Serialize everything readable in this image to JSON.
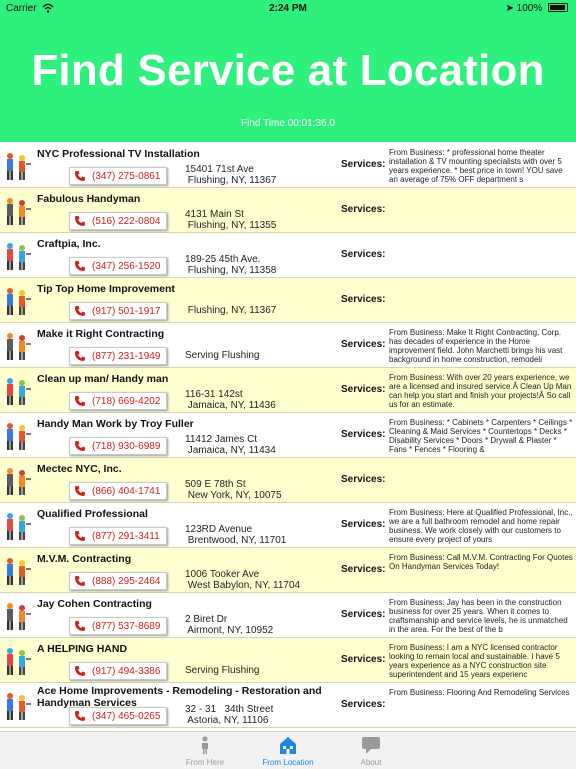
{
  "status": {
    "carrier": "Carrier",
    "time": "2:24 PM",
    "battery": "100%"
  },
  "header": {
    "title": "Find Service at Location",
    "find_time": "Find Time 00:01:36.0"
  },
  "services_label": "Services:",
  "listings": [
    {
      "name": "NYC Professional TV Installation",
      "phone": "(347) 275-0861",
      "address": "15401 71st Ave\n Flushing, NY, 11367",
      "description": "From Business: * professional home theater installation & TV mounting specialists with over 5 years experience. * best price in town! YOU save an average of 75% OFF department s"
    },
    {
      "name": "Fabulous Handyman",
      "phone": "(516) 222-0804",
      "address": "4131 Main St\n Flushing, NY, 11355",
      "description": ""
    },
    {
      "name": "Craftpia, Inc.",
      "phone": "(347) 256-1520",
      "address": "189-25 45th Ave.\n Flushing, NY, 11358",
      "description": ""
    },
    {
      "name": "Tip Top Home Improvement",
      "phone": "(917) 501-1917",
      "address": " Flushing, NY, 11367",
      "description": ""
    },
    {
      "name": "Make it Right Contracting",
      "phone": "(877) 231-1949",
      "address": "Serving Flushing",
      "description": "From Business: Make It Right Contracting, Corp. has decades of experience in the Home improvement field. John Marchetti brings his vast background in home construction, remodeli"
    },
    {
      "name": "Clean up man/ Handy man",
      "phone": "(718) 669-4202",
      "address": "116-31 142st\n Jamaica, NY, 11436",
      "description": "From Business: With over 20 years experience, we are a licensed and insured service.Â Clean Up Man can help you start and finish your projects!Â So call us for an estimate."
    },
    {
      "name": "Handy Man Work by Troy Fuller",
      "phone": "(718) 930-6989",
      "address": "11412 James Ct\n Jamaica, NY, 11434",
      "description": "From Business: * Cabinets * Carpenters * Ceilings * Cleaning & Maid Services * Countertops * Decks * Disability Services * Doors * Drywall & Plaster * Fans * Fences * Flooring &"
    },
    {
      "name": "Mectec NYC, Inc.",
      "phone": "(866) 404-1741",
      "address": "509 E 78th St\n New York, NY, 10075",
      "description": ""
    },
    {
      "name": "Qualified Professional",
      "phone": "(877) 291-3411",
      "address": "123RD Avenue\n Brentwood, NY, 11701",
      "description": "From Business: Here at Qualified Professional, Inc., we are a full bathroom remodel and home repair business. We work closely with our customers to ensure every project of yours"
    },
    {
      "name": "M.V.M. Contracting",
      "phone": "(888) 295-2464",
      "address": "1006 Tooker Ave\n West Babylon, NY, 11704",
      "description": "From Business: Call M.V.M. Contracting For Quotes On Handyman Services Today!"
    },
    {
      "name": "Jay Cohen Contracting",
      "phone": "(877) 537-8689",
      "address": "2 Biret Dr\n Airmont, NY, 10952",
      "description": "From Business: Jay has been in the construction business for over 25 years. When it comes to craftsmanship and service levels, he is unmatched in the area. For the best of the b"
    },
    {
      "name": "A HELPING HAND",
      "phone": "(917) 494-3386",
      "address": "Serving Flushing",
      "description": "From Business: I am a NYC licensed contractor looking to remain local and sustainable. I have 5 years experience as a NYC construction site superintendent and 15 years experienc"
    },
    {
      "name": "Ace Home Improvements - Remodeling - Restoration and Handyman Services",
      "phone": "(347) 465-0265",
      "address": "32 - 31   34th Street\n Astoria, NY, 11106",
      "description": "From Business: Flooring And Remodeling Services"
    }
  ],
  "tabs": [
    {
      "label": "From Here",
      "icon": "person-icon"
    },
    {
      "label": "From Location",
      "icon": "building-icon"
    },
    {
      "label": "About",
      "icon": "speech-bubble-icon"
    }
  ],
  "colors": {
    "header": "#2ef07c",
    "row_alt": "#ffffd0",
    "phone_text": "#d02020",
    "tab_active": "#1a86e8"
  }
}
